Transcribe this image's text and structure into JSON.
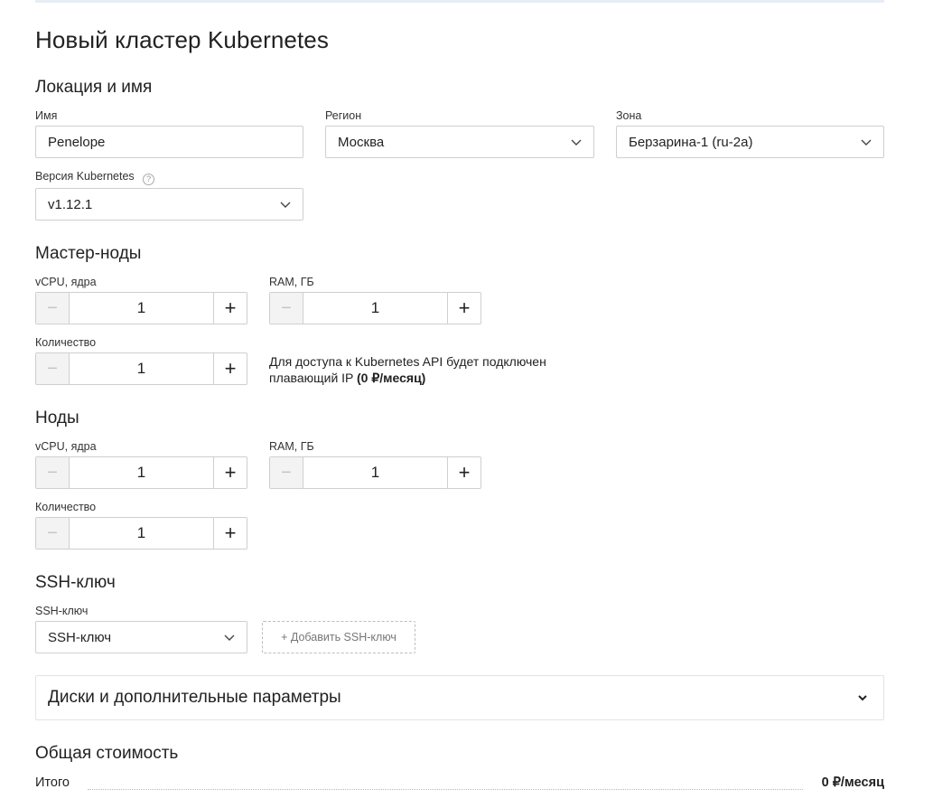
{
  "page_title": "Новый кластер Kubernetes",
  "location_section": {
    "title": "Локация и имя",
    "name_label": "Имя",
    "name_value": "Penelope",
    "region_label": "Регион",
    "region_value": "Москва",
    "zone_label": "Зона",
    "zone_value": "Берзарина-1 (ru-2a)",
    "version_label": "Версия Kubernetes",
    "version_help": "?",
    "version_value": "v1.12.1"
  },
  "master_section": {
    "title": "Мастер-ноды",
    "vcpu_label": "vCPU, ядра",
    "vcpu_value": "1",
    "ram_label": "RAM, ГБ",
    "ram_value": "1",
    "count_label": "Количество",
    "count_value": "1",
    "api_note_line1": "Для доступа к Kubernetes API будет подключен",
    "api_note_line2": "плавающий IP ",
    "api_note_price": "(0 ₽/месяц)"
  },
  "nodes_section": {
    "title": "Ноды",
    "vcpu_label": "vCPU, ядра",
    "vcpu_value": "1",
    "ram_label": "RAM, ГБ",
    "ram_value": "1",
    "count_label": "Количество",
    "count_value": "1"
  },
  "stepper": {
    "minus": "−",
    "plus": "+"
  },
  "ssh_section": {
    "title": "SSH-ключ",
    "field_label": "SSH-ключ",
    "select_value": "SSH-ключ",
    "add_button": "+ Добавить SSH-ключ"
  },
  "advanced": {
    "label": "Диски и дополнительные параметры"
  },
  "cost_section": {
    "title": "Общая стоимость",
    "total_label": "Итого",
    "total_value": "0 ₽/месяц"
  },
  "colors": {
    "border": "#cfcfcf",
    "stepper_disabled_bg": "#f3f3f3",
    "text": "#222222"
  },
  "icons": {
    "select": "chevron-down-icon",
    "help": "question-circle-icon"
  }
}
